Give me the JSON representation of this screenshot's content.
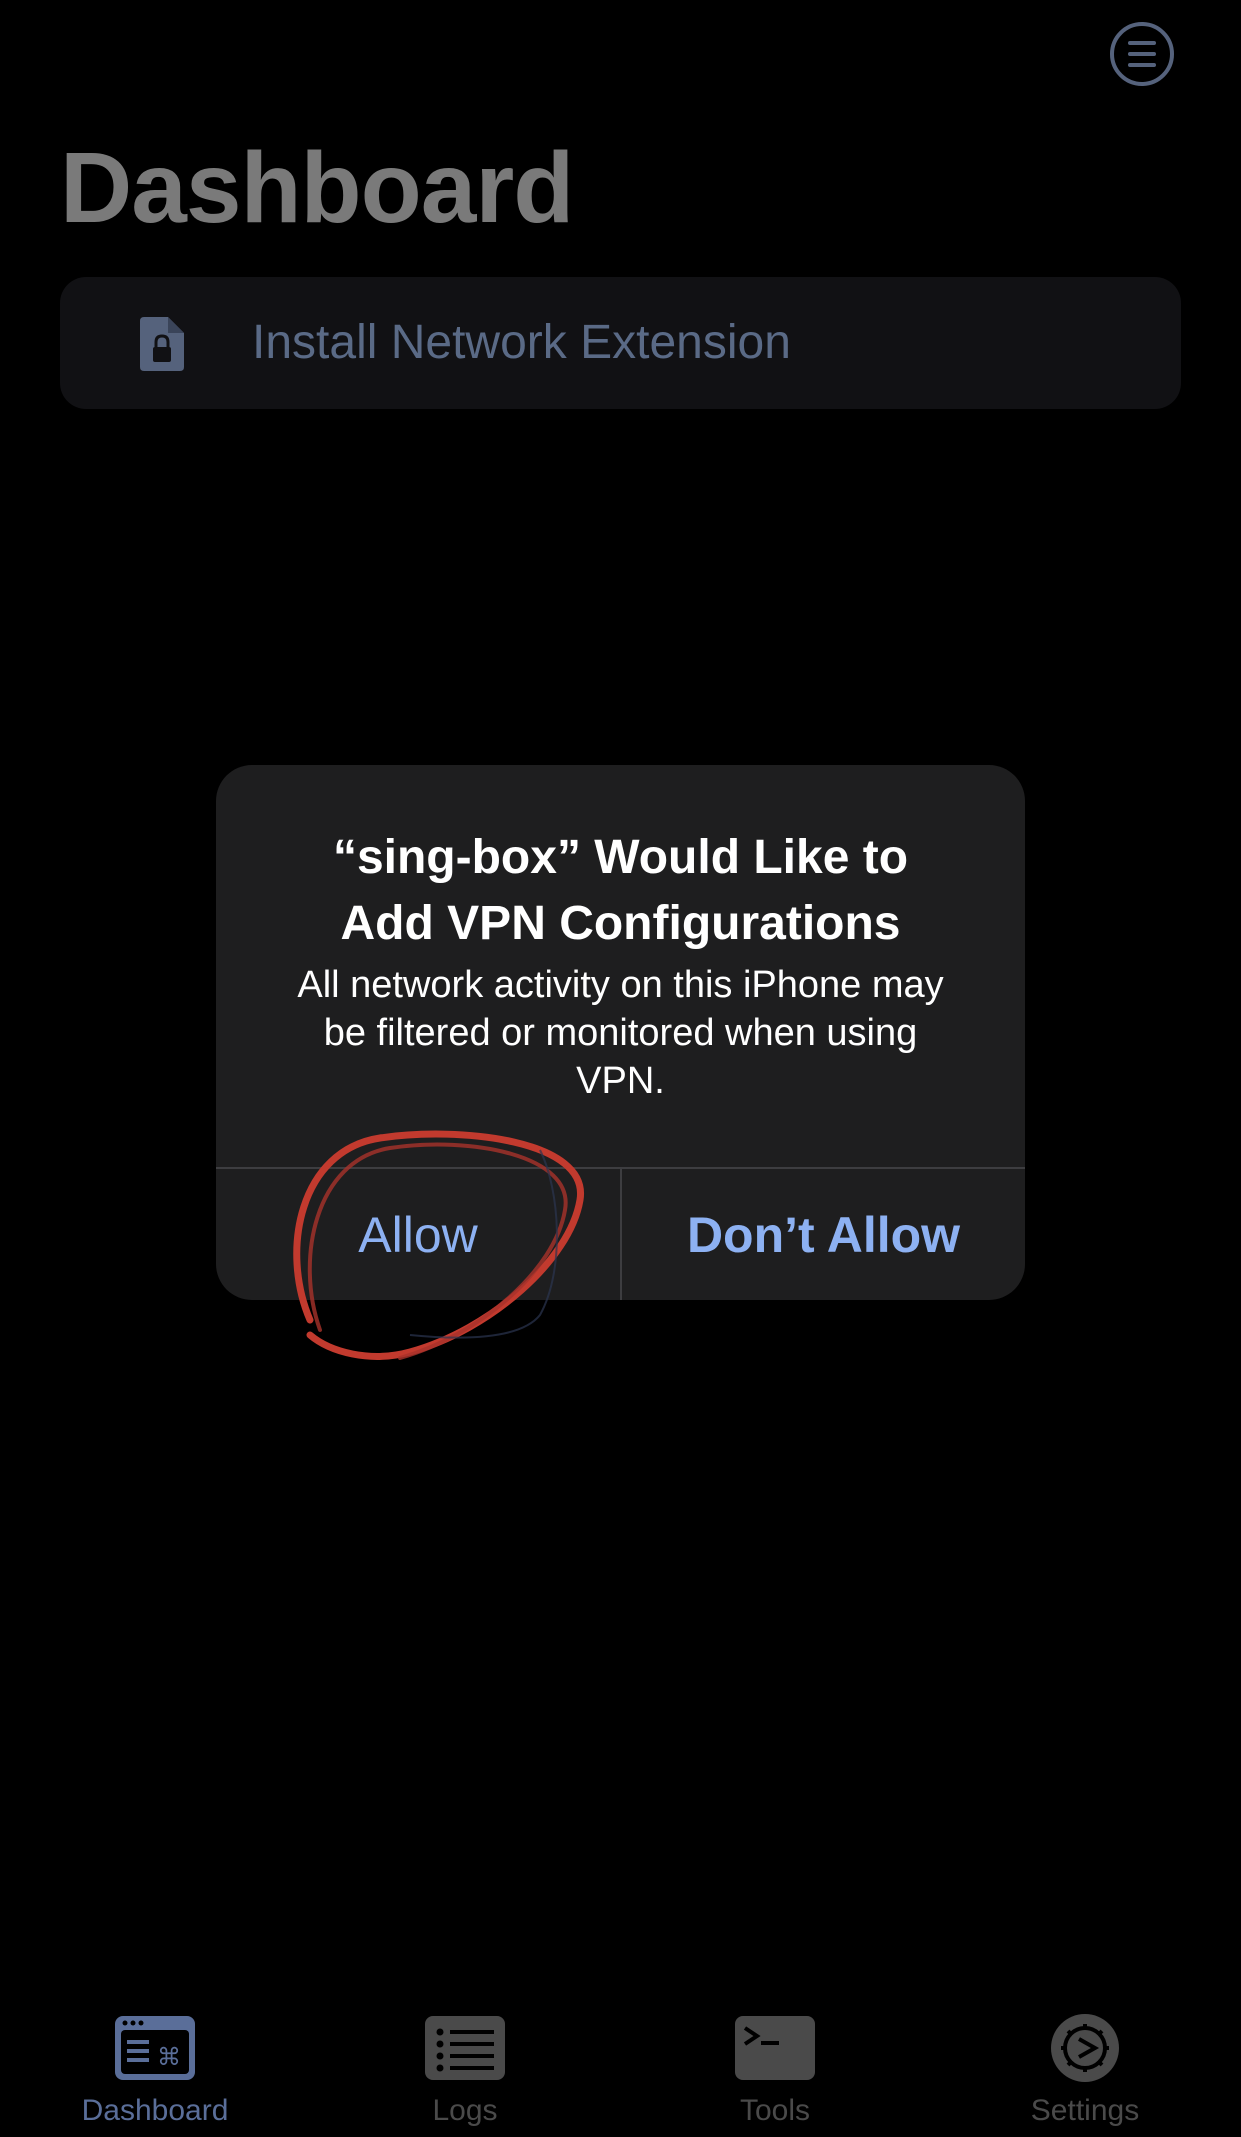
{
  "header": {
    "menu_icon": "list-circle-icon",
    "title": "Dashboard"
  },
  "install_card": {
    "icon": "document-lock-icon",
    "label": "Install Network Extension"
  },
  "alert": {
    "title_line1": "“sing-box” Would Like to",
    "title_line2": "Add VPN Configurations",
    "message_line1": "All network activity on this iPhone may",
    "message_line2": "be filtered or monitored when using",
    "message_line3": "VPN.",
    "allow_label": "Allow",
    "deny_label": "Don’t Allow"
  },
  "annotation": {
    "shape": "hand-drawn circle around Allow",
    "color": "#c23a2e"
  },
  "tabbar": {
    "tabs": [
      {
        "label": "Dashboard",
        "icon": "dashboard-icon",
        "selected": true
      },
      {
        "label": "Logs",
        "icon": "list-icon",
        "selected": false
      },
      {
        "label": "Tools",
        "icon": "terminal-icon",
        "selected": false
      },
      {
        "label": "Settings",
        "icon": "gear-icon",
        "selected": false
      }
    ]
  },
  "colors": {
    "background": "#000000",
    "alert_background": "#1e1e1f",
    "alert_button_text": "#8db1f2",
    "dimmed_accent": "#55627c",
    "dimmed_text": "#7a7a7a",
    "tab_selected": "#5a6e99",
    "tab_unselected": "#4a4a4a"
  }
}
